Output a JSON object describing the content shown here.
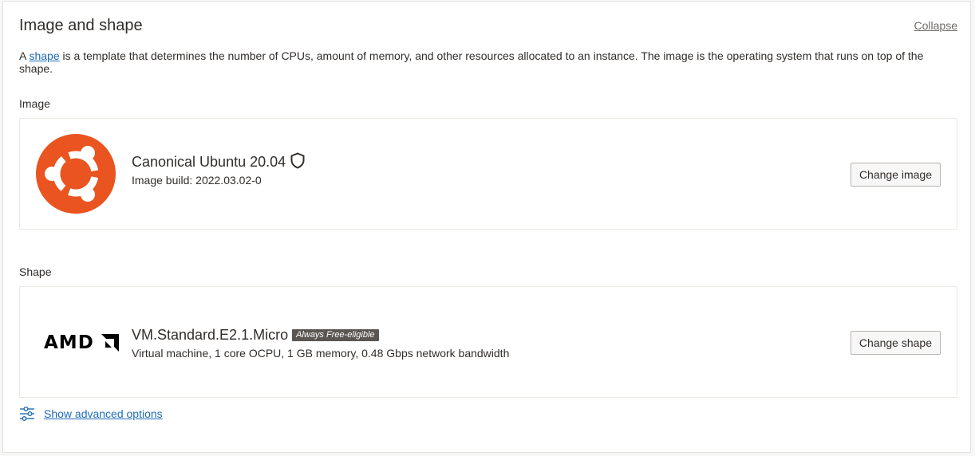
{
  "section": {
    "title": "Image and shape",
    "collapse_label": "Collapse",
    "description_prefix": "A ",
    "description_link": "shape",
    "description_suffix": " is a template that determines the number of CPUs, amount of memory, and other resources allocated to an instance. The image is the operating system that runs on top of the shape."
  },
  "image": {
    "label": "Image",
    "logo_icon": "ubuntu-logo",
    "name": "Canonical Ubuntu 20.04",
    "verified_icon": "shield-icon",
    "build": "Image build: 2022.03.02-0",
    "button_label": "Change image"
  },
  "shape": {
    "label": "Shape",
    "logo_icon": "amd-logo",
    "logo_text": "AMD",
    "name": "VM.Standard.E2.1.Micro",
    "badge": "Always Free-eligible",
    "details": "Virtual machine, 1 core OCPU, 1 GB memory, 0.48 Gbps network bandwidth",
    "button_label": "Change shape"
  },
  "advanced": {
    "icon": "sliders-icon",
    "label": "Show advanced options"
  },
  "colors": {
    "link": "#1e6bb8",
    "ubuntu_orange": "#e95420",
    "badge_bg": "#5b5652"
  }
}
